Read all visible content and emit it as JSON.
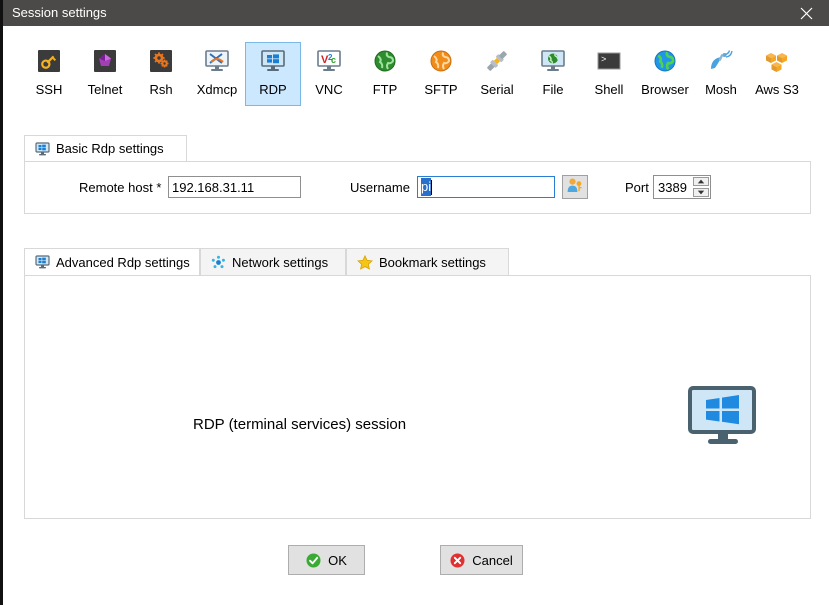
{
  "window": {
    "title": "Session settings",
    "close_icon": "close-icon"
  },
  "protocols": [
    {
      "label": "SSH",
      "icon": "key-icon"
    },
    {
      "label": "Telnet",
      "icon": "purple-gem-icon"
    },
    {
      "label": "Rsh",
      "icon": "orange-gears-icon"
    },
    {
      "label": "Xdmcp",
      "icon": "x-monitor-icon"
    },
    {
      "label": "RDP",
      "icon": "windows-monitor-icon",
      "selected": true
    },
    {
      "label": "VNC",
      "icon": "vnc-monitor-icon"
    },
    {
      "label": "FTP",
      "icon": "green-globe-icon"
    },
    {
      "label": "SFTP",
      "icon": "orange-globe-icon"
    },
    {
      "label": "Serial",
      "icon": "serial-plug-icon"
    },
    {
      "label": "File",
      "icon": "globe-monitor-icon"
    },
    {
      "label": "Shell",
      "icon": "terminal-icon"
    },
    {
      "label": "Browser",
      "icon": "blue-globe-icon"
    },
    {
      "label": "Mosh",
      "icon": "satellite-dish-icon"
    },
    {
      "label": "Aws S3",
      "icon": "aws-cubes-icon"
    }
  ],
  "basic": {
    "tab_label": "Basic Rdp settings",
    "tab_icon": "monitor-icon",
    "remote_host_label": "Remote host *",
    "remote_host_value": "192.168.31.11",
    "username_label": "Username",
    "username_value": "pi",
    "username_selected": true,
    "credentials_button_icon": "user-key-icon",
    "port_label": "Port",
    "port_value": "3389",
    "spin_up_icon": "chevron-up-icon",
    "spin_down_icon": "chevron-down-icon"
  },
  "advanced_tabs": [
    {
      "label": "Advanced Rdp settings",
      "icon": "monitor-icon",
      "active": true
    },
    {
      "label": "Network settings",
      "icon": "network-dots-icon",
      "active": false
    },
    {
      "label": "Bookmark settings",
      "icon": "star-icon",
      "active": false
    }
  ],
  "panel": {
    "description": "RDP (terminal services) session",
    "graphic_icon": "windows-monitor-large-icon"
  },
  "buttons": {
    "ok_label": "OK",
    "ok_icon": "green-check-icon",
    "cancel_label": "Cancel",
    "cancel_icon": "red-x-icon"
  },
  "colors": {
    "titlebar_bg": "#4c4a48",
    "selection_bg": "#cce8ff",
    "selection_border": "#7ab8e8",
    "text_selection": "#2a6fc9",
    "focus_border": "#2a7fd4",
    "ok_green": "#3aaa35",
    "cancel_red": "#e03131"
  }
}
